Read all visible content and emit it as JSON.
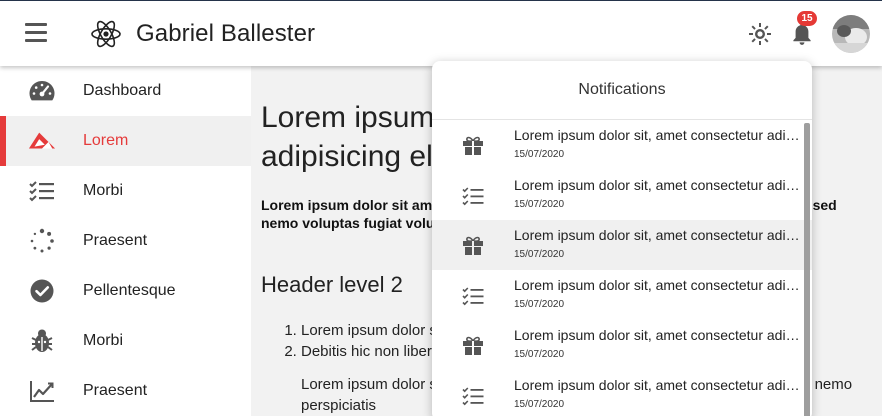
{
  "app": {
    "title": "Gabriel Ballester",
    "logo_icon": "react-atom-icon",
    "notification_count": "15"
  },
  "colors": {
    "accent": "#e53b3b",
    "badge": "#e53935",
    "text": "#222222",
    "sidebar_active_bg": "#f0f0f0"
  },
  "sidebar": {
    "items": [
      {
        "label": "Dashboard",
        "icon": "speedometer-icon"
      },
      {
        "label": "Lorem",
        "icon": "red-logo-icon",
        "active": true
      },
      {
        "label": "Morbi",
        "icon": "checklist-icon"
      },
      {
        "label": "Praesent",
        "icon": "dotted-circle-icon"
      },
      {
        "label": "Pellentesque",
        "icon": "check-circle-icon"
      },
      {
        "label": "Morbi",
        "icon": "bug-icon"
      },
      {
        "label": "Praesent",
        "icon": "chart-line-icon"
      }
    ]
  },
  "main": {
    "h1": "Lorem ipsum dolor sit amet consectetur, adipisicing elit.",
    "lead": "Lorem ipsum dolor sit amet consectetur adipisicing elit. Eum nulla iure eius rerum sed nemo voluptas fugiat voluptatem fuga labore assumenda eos qui",
    "h2": "Header level 2",
    "list": [
      "Lorem ipsum dolor sit amet consectetur adipisicing elit.",
      "Debitis hic non libero quasi necessitatibus."
    ],
    "para": "Lorem ipsum dolor sit amet consectetur adipisicing elit facilis delectus aliquid nemo perspiciatis"
  },
  "notifications": {
    "header": "Notifications",
    "items": [
      {
        "title": "Lorem ipsum dolor sit, amet consectetur adipisicing elit.",
        "date": "15/07/2020",
        "icon": "gift-icon"
      },
      {
        "title": "Lorem ipsum dolor sit, amet consectetur adipisicing elit.",
        "date": "15/07/2020",
        "icon": "checklist-icon"
      },
      {
        "title": "Lorem ipsum dolor sit, amet consectetur adipisicing elit.",
        "date": "15/07/2020",
        "icon": "gift-icon"
      },
      {
        "title": "Lorem ipsum dolor sit, amet consectetur adipisicing elit.",
        "date": "15/07/2020",
        "icon": "checklist-icon"
      },
      {
        "title": "Lorem ipsum dolor sit, amet consectetur adipisicing elit.",
        "date": "15/07/2020",
        "icon": "gift-icon"
      },
      {
        "title": "Lorem ipsum dolor sit, amet consectetur adipisicing elit.",
        "date": "15/07/2020",
        "icon": "checklist-icon"
      }
    ]
  }
}
